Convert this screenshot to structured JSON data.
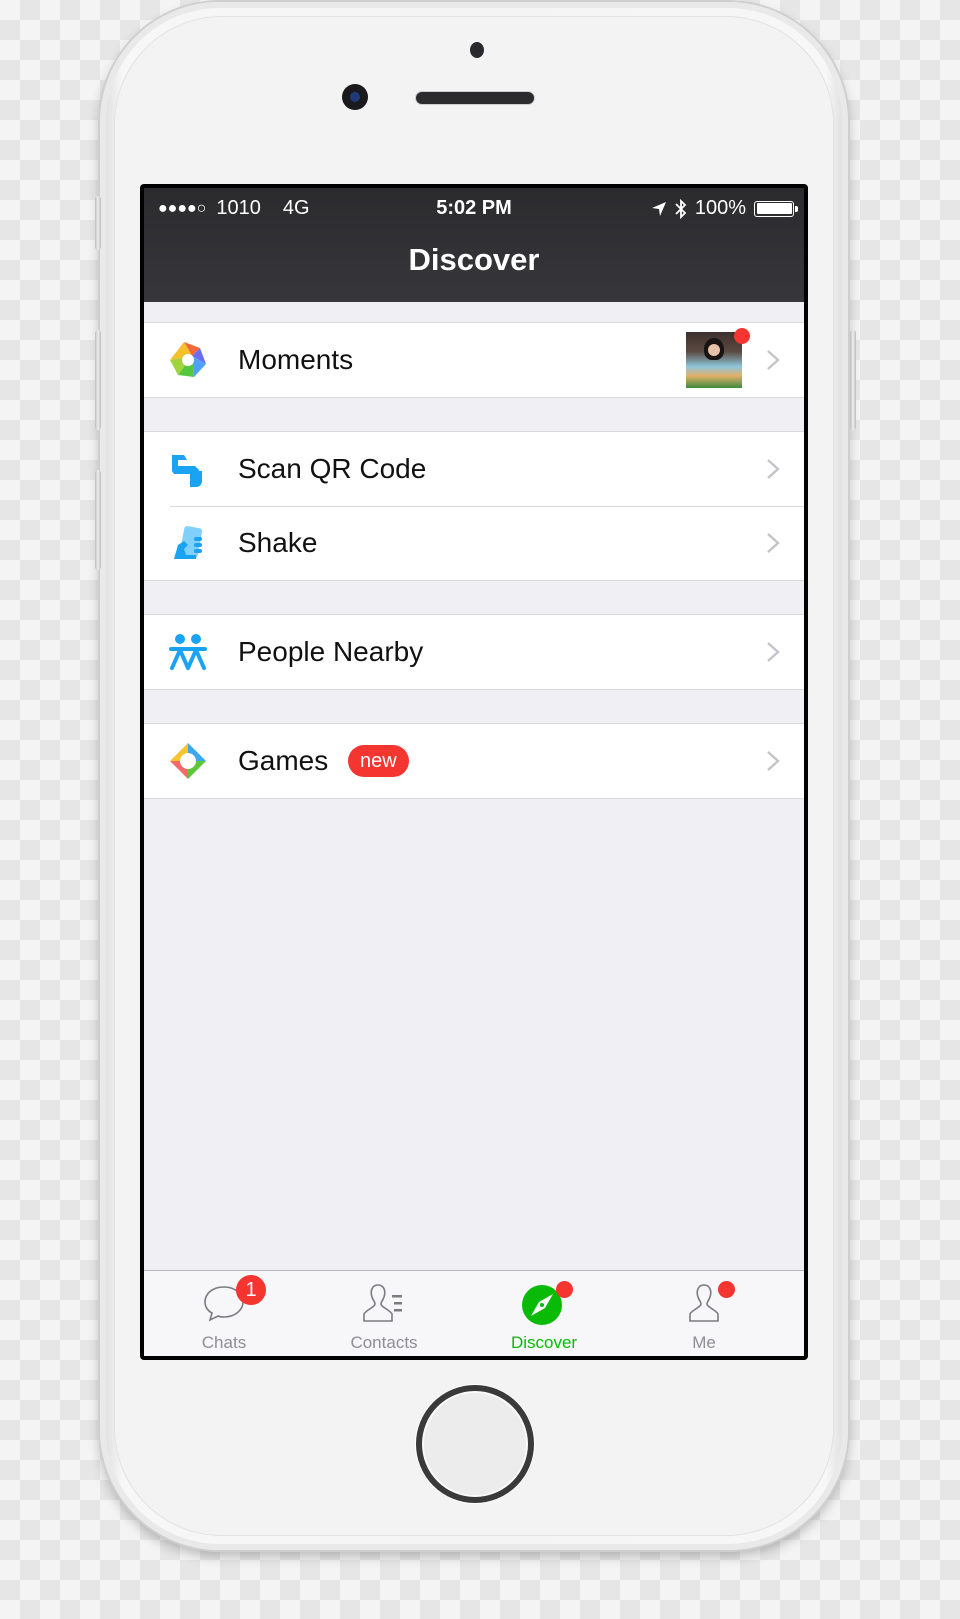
{
  "device": {
    "type": "smartphone mockup",
    "color": "silver"
  },
  "status_bar": {
    "signal": "●●●●○",
    "carrier": "1010",
    "network": "4G",
    "time": "5:02 PM",
    "location_icon": "location-arrow-icon",
    "bluetooth_icon": "bluetooth-icon",
    "battery_percent": "100%",
    "battery_level": 1.0
  },
  "nav": {
    "title": "Discover"
  },
  "groups": [
    {
      "items": [
        {
          "label": "Moments",
          "icon": "moments-aperture-icon",
          "has_thumbnail": true,
          "has_dot": true
        }
      ]
    },
    {
      "items": [
        {
          "label": "Scan QR Code",
          "icon": "scan-qr-icon"
        },
        {
          "label": "Shake",
          "icon": "shake-phone-icon"
        }
      ]
    },
    {
      "items": [
        {
          "label": "People Nearby",
          "icon": "people-nearby-icon"
        }
      ]
    },
    {
      "items": [
        {
          "label": "Games",
          "icon": "games-icon",
          "badge": "new"
        }
      ]
    }
  ],
  "tabbar": {
    "tabs": [
      {
        "label": "Chats",
        "icon": "chat-bubble-icon",
        "badge": "1",
        "active": false
      },
      {
        "label": "Contacts",
        "icon": "contacts-icon",
        "active": false
      },
      {
        "label": "Discover",
        "icon": "compass-icon",
        "dot": true,
        "active": true
      },
      {
        "label": "Me",
        "icon": "person-icon",
        "dot": true,
        "active": false
      }
    ]
  },
  "colors": {
    "accent_green": "#09bb07",
    "badge_red": "#f43530",
    "navbar": "#313134",
    "background": "#efeff4"
  }
}
